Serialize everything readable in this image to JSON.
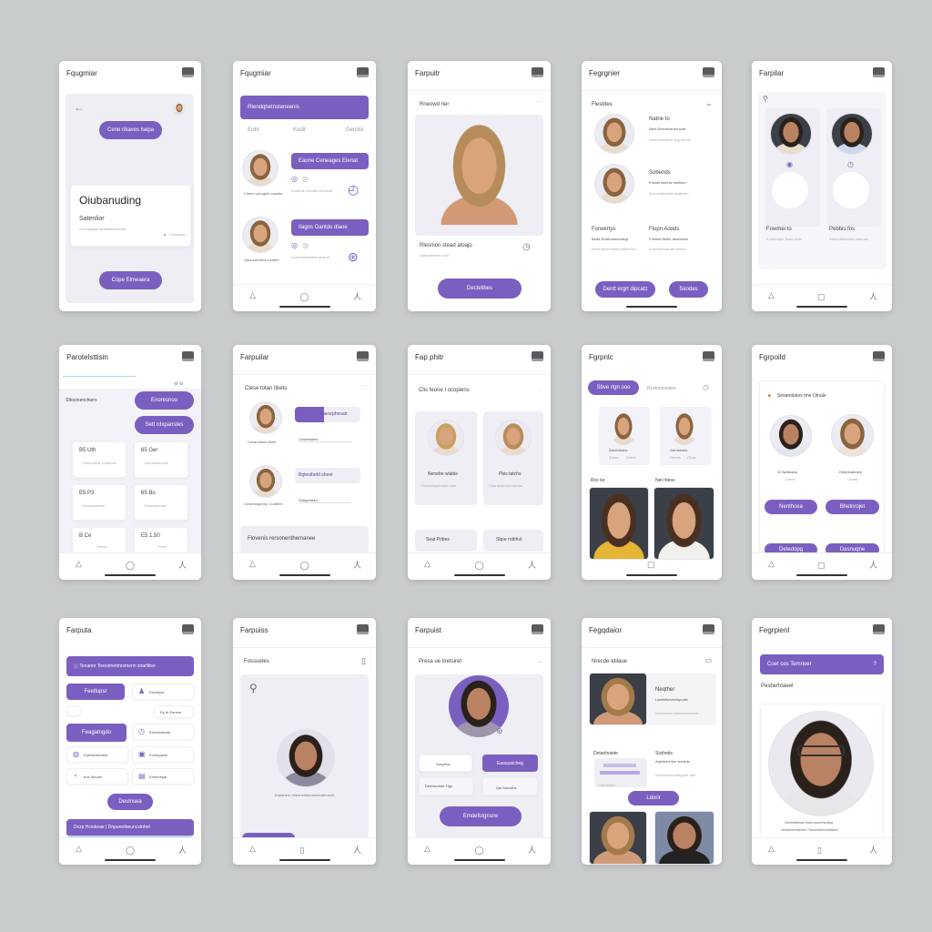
{
  "accent_color": "#7b5fc0",
  "nav_icons": [
    "bell-icon",
    "chat-icon",
    "profile-icon"
  ],
  "screens": [
    {
      "title": "Fqugmiar",
      "top_button": "Cene rikaves lsepa",
      "card_title": "Oiubanuding",
      "card_subtitle": "Satenlior",
      "card_text": "Gondngdge fanabhtlemerwer",
      "card_tag": "Cinanaca",
      "bottom_button": "Cope Elmeaera"
    },
    {
      "title": "Fqugmiar",
      "banner": "Rtendqhetnsteneenis",
      "tabs": [
        "Erdit",
        "Kedit",
        "Gendor"
      ],
      "rows": [
        {
          "name": "Clmes cacnghts casahe",
          "action": "Eaone Ceneages Elenat",
          "text": "Keathde ceadee elhlnede"
        },
        {
          "name": "Oaunnarntied cnuthet",
          "action": "Ilagos Oantdo dlaoe",
          "text": "Eonmurabbtaed aeanre"
        }
      ]
    },
    {
      "title": "Farpuitr",
      "section": "Rneowd rier",
      "caption": "Rlesnion stead atoajo",
      "caption_sub": "Eaeanfeerter neer",
      "button": "Dectelibes"
    },
    {
      "title": "Fegrgnier",
      "section": "Flesbtes",
      "section_badge": "es",
      "rows": [
        {
          "name": "Natne to",
          "sub": "Nent Etrinmnsned tuse",
          "text": "Sereenendens ang tetnne"
        },
        {
          "name": "Sobends",
          "sub": "Frisnet tieet ar ebeticer",
          "text": "Ssenerderbeds teatseter"
        }
      ],
      "cols": [
        {
          "name": "Forwertys",
          "sub": "Betfd Ensitnmunestegl",
          "text": "Beeenenoedeeta eaeeerme"
        },
        {
          "name": "Flopn Aoods",
          "sub": "Fnbnett tbitee abobcbes",
          "text": "Snerrirrerearate beerre"
        }
      ],
      "button_primary": "Dentt ergrt dipcatz",
      "button_secondary": "Seodes"
    },
    {
      "title": "Farpilar",
      "cards": [
        {
          "name": "Fowmei to",
          "text": "Eonnentpe Seen eoat"
        },
        {
          "name": "Pebbis fos",
          "text": "Seenetfsteestie eaeeres"
        }
      ]
    },
    {
      "title": "Parotelsttisin",
      "label": "Sftoctnenchiers",
      "button1": "Enoresnoo",
      "button2": "Sett rdxpanstes",
      "tiles": [
        {
          "label": "B5 Uth",
          "sub": "Cesonetear Cenebes"
        },
        {
          "label": "65 Ger",
          "sub": "Ceoneasbnsee"
        },
        {
          "label": "E5 P3",
          "sub": "Cinoanaamee"
        },
        {
          "label": "65 Bo",
          "sub": "Cenenaeeeee"
        },
        {
          "label": "B Ce",
          "sub": "Seeoe"
        },
        {
          "label": "E5 1.50",
          "sub": "Seeb"
        }
      ]
    },
    {
      "title": "Farpuilar",
      "section": "Clese totan tibets",
      "rows": [
        {
          "name": "Cesanuthes tibeh",
          "bar": "Eaesrphesatr",
          "progress": 45,
          "field": "Cestebaees"
        },
        {
          "name": "Cienenbaphisc Conthen",
          "bar": "Bgtestbetd sheet",
          "progress": 0,
          "field": "Sntspetleen"
        }
      ],
      "footer": "Flovenis rersonenthemanee"
    },
    {
      "title": "Fap phitr",
      "section": "Clis feone I ocopiens",
      "cards": [
        {
          "name": "Nenebe wiabie",
          "text": "Cleanseepmeate eare"
        },
        {
          "name": "Pbis tatchs",
          "text": "Ceantebeusd eaeran"
        }
      ],
      "bottom": [
        "Seat Pribes",
        "Sbpe rotbhst"
      ]
    },
    {
      "title": "Fgrpnlc",
      "tabs": [
        "Sbve rlgn ooo",
        "Rostuntnsstee"
      ],
      "cards": [
        {
          "name": "Dmdmbobs",
          "meta": [
            "Etnes",
            "Cotes"
          ]
        },
        {
          "name": "Gemsbobs",
          "meta": [
            "Genes",
            "Ooas"
          ]
        }
      ],
      "labels": [
        "Roc ke",
        "Net rbese"
      ]
    },
    {
      "title": "Fgrpoild",
      "section": "Sesamdates tme Otnale",
      "people": [
        {
          "name": "10 fwdteaea",
          "sub": "Ceeer"
        },
        {
          "name": "Dhepeuttedes",
          "sub": "Osalte"
        }
      ],
      "buttons": [
        "Nenthcea",
        "Bhetnrojet",
        "Detedopg",
        "Dasnuqne"
      ]
    },
    {
      "title": "Farputa",
      "banner": "Tenanre Tesnetrentnrsmenn snarlitisn",
      "items": [
        "Feetlupsr",
        "Eeeelipsr",
        "Ep fe Eaneer",
        "Feagatngdo",
        "Eeewnabolar",
        "Epeesbiesnbar",
        "Eoolegaber",
        "eue Idnolar",
        "Eneunepar"
      ],
      "button": "Deulnsea",
      "footer": "Dczp Hciokeae | Dnpunetbeuncstnhet"
    },
    {
      "title": "Farpuiss",
      "section": "Fossuetes",
      "caption": "Eaeaneur nheenenbanneeterahnecd"
    },
    {
      "title": "Farpuist",
      "section": "Presa ue tiretsiret",
      "options": [
        "Sdcpfisa",
        "Eaoausicheg",
        "Deetsectnet Tlgs",
        "Dpl.Savsdhs"
      ],
      "button": "Emdefutgnsrw"
    },
    {
      "title": "Fegqdaior",
      "section": "Nrecde-tdilaue",
      "feature": {
        "name": "Neqther",
        "sub": "Larstnfsesesfuprpdc",
        "text": "Seenfeeue beeneeneeteer"
      },
      "cols": [
        {
          "name": "Detanhoiete",
          "caption": "Canbseres"
        },
        {
          "name": "Sisthetis",
          "sub": "Aqeriiche/foe fernitde",
          "text": "Seeneenetnrdegeae dee"
        }
      ],
      "button": "Ldorir"
    },
    {
      "title": "Fegrpienl",
      "banner": "Coet ces Temnoer",
      "banner_icon": "?",
      "section": "Pesberhtaeel",
      "caption": [
        "Obeteflebae eluenuceefsebsa",
        "Yeaeneehtbeien Tenetbeencbhetee"
      ]
    }
  ]
}
